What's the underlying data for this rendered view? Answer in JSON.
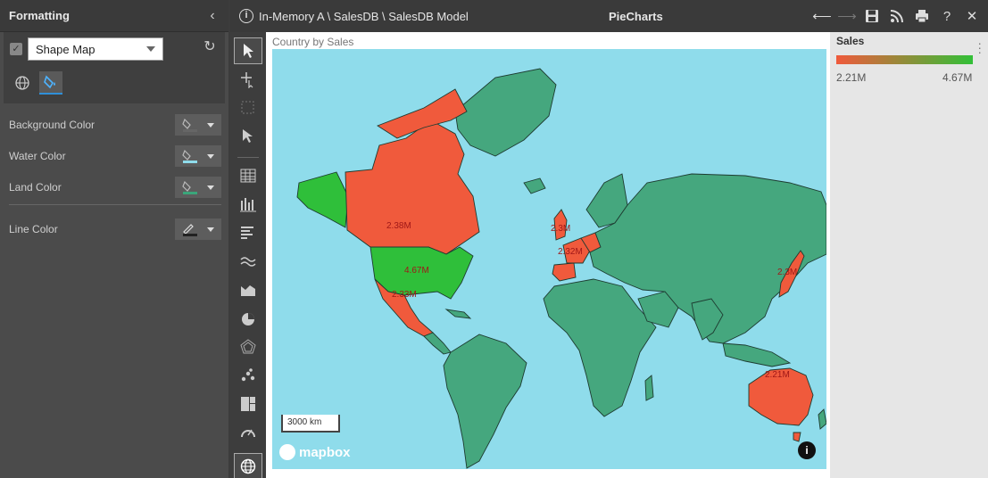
{
  "formatting": {
    "title": "Formatting",
    "chart_type": "Shape Map",
    "rows": [
      {
        "label": "Background Color",
        "bar_color": "#666666"
      },
      {
        "label": "Water Color",
        "bar_color": "#8fdceb"
      },
      {
        "label": "Land Color",
        "bar_color": "#3aa57a"
      },
      {
        "label": "Line Color",
        "bar_color": "#222222"
      }
    ]
  },
  "header": {
    "path": "In-Memory A \\ SalesDB \\ SalesDB Model",
    "dashboard_title": "PieCharts"
  },
  "canvas": {
    "title": "Country by Sales",
    "scale_label": "3000 km",
    "attribution": "mapbox"
  },
  "map_labels": {
    "canada": "2.38M",
    "usa": "4.67M",
    "mexico": "2.33M",
    "uk": "2.3M",
    "france": "2.32M",
    "japan": "2.3M",
    "australia": "2.21M"
  },
  "legend": {
    "title": "Sales",
    "min": "2.21M",
    "max": "4.67M",
    "colors": {
      "low": "#f05a3c",
      "high": "#32c038"
    }
  },
  "colors": {
    "land": "#45a77e",
    "water": "#8fdceb",
    "low_sales": "#f05a3c",
    "high_sales": "#2fbf3a"
  }
}
